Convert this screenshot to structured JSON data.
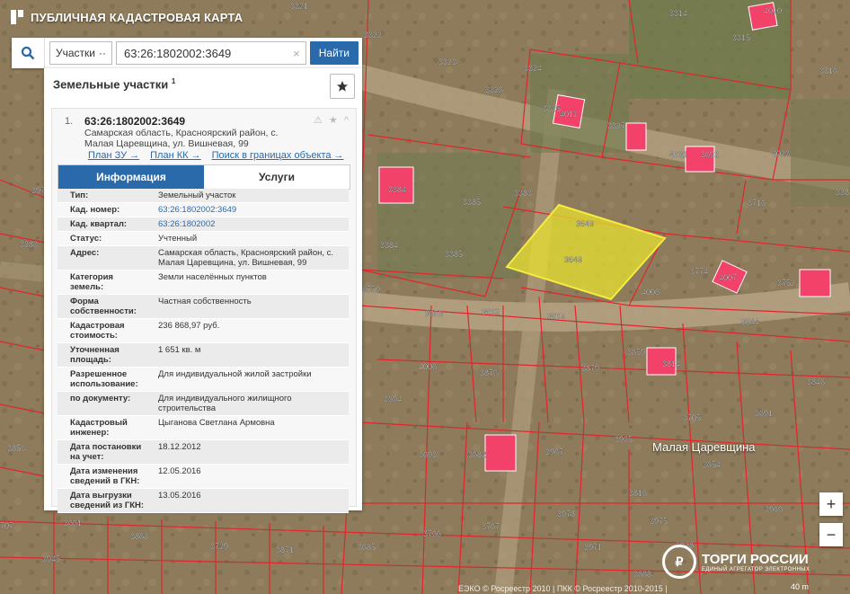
{
  "header": {
    "title": "ПУБЛИЧНАЯ КАДАСТРОВАЯ КАРТА"
  },
  "search": {
    "type_label": "Участки",
    "type_arrow": "··",
    "query": "63:26:1802002:3649",
    "clear": "×",
    "find_label": "Найти"
  },
  "panel": {
    "title": "Земельные участки",
    "title_count": "1",
    "item": {
      "number": "1.",
      "cad_id": "63:26:1802002:3649",
      "address": "Самарская область, Красноярский район, с. Малая Царевщина, ул. Вишневая, 99",
      "icons": "⚠ ★ ^",
      "links": [
        "План ЗУ →",
        "План КК →",
        "Поиск в границах объекта →"
      ],
      "tabs": {
        "info": "Информация",
        "services": "Услуги"
      },
      "rows": [
        {
          "label": "Тип:",
          "value": "Земельный участок",
          "link": false
        },
        {
          "label": "Кад. номер:",
          "value": "63:26:1802002:3649",
          "link": true
        },
        {
          "label": "Кад. квартал:",
          "value": "63:26:1802002",
          "link": true
        },
        {
          "label": "Статус:",
          "value": "Учтенный",
          "link": false
        },
        {
          "label": "Адрес:",
          "value": "Самарская область, Красноярский район, с. Малая Царевщина, ул. Вишневая, 99",
          "link": false
        },
        {
          "label": "Категория земель:",
          "value": "Земли населённых пунктов",
          "link": false
        },
        {
          "label": "Форма собственности:",
          "value": "Частная собственность",
          "link": false
        },
        {
          "label": "Кадастровая стоимость:",
          "value": "236 868,97 руб.",
          "link": false
        },
        {
          "label": "Уточненная площадь:",
          "value": "1 651 кв. м",
          "link": false
        },
        {
          "label": "Разрешенное использование:",
          "value": "Для индивидуальной жилой застройки",
          "link": false
        },
        {
          "label": "по документу:",
          "value": "Для индивидуального жилищного строительства",
          "link": false
        },
        {
          "label": "Кадастровый инженер:",
          "value": "Цыганова Светлана Армовна",
          "link": false
        },
        {
          "label": "Дата постановки на учет:",
          "value": "18.12.2012",
          "link": false
        },
        {
          "label": "Дата изменения сведений в ГКН:",
          "value": "12.05.2016",
          "link": false
        },
        {
          "label": "Дата выгрузки сведений из ГКН:",
          "value": "13.05.2016",
          "link": false
        }
      ]
    }
  },
  "map": {
    "place_name": "Малая Царевщина",
    "labels": [
      "3321",
      "3322",
      "3314",
      "3315",
      "4010",
      "3323",
      "3324",
      "3316",
      "3325",
      "3326",
      "3327",
      "4031",
      "3692",
      "4023",
      "4011",
      "3384",
      "3385",
      "3383",
      "3716",
      "3385",
      "3384",
      "3649",
      "3649",
      "3774",
      "4007",
      "3752",
      "4008",
      "3653",
      "3802",
      "3809",
      "3844",
      "3659",
      "3814",
      "4006",
      "3876",
      "3879",
      "3846",
      "3694",
      "3705",
      "3691",
      "3693",
      "3682",
      "3967",
      "3965",
      "3654",
      "3816",
      "3978",
      "3969",
      "3661",
      "3868",
      "3729",
      "3871",
      "3685",
      "3766",
      "3767",
      "3971",
      "3928",
      "3975",
      "3945",
      "3668",
      "3977",
      "3283",
      "328",
      "3853",
      "3759",
      "707",
      "3760"
    ],
    "attribution": "ЕЭКО © Росреестр 2010 | ПКК © Росреестр 2010-2015 |"
  },
  "zoom": {
    "in": "+",
    "out": "−"
  },
  "brand": {
    "name": "ТОРГИ РОССИИ",
    "sub": "ЕДИНЫЙ АГРЕГАТОР ЭЛЕКТРОННЫХ",
    "scale": "40 m"
  },
  "colors": {
    "accent": "#2a6aab",
    "parcel": "#e8e030",
    "boundary": "#e0262c",
    "building": "#f2426a"
  }
}
